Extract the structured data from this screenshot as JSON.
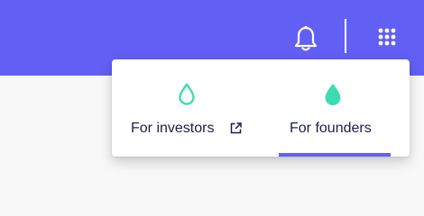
{
  "header": {
    "background": "#625ff5",
    "icons": [
      "bell-icon",
      "apps-grid-icon"
    ]
  },
  "menu": {
    "items": [
      {
        "label": "For investors",
        "icon": "drop-outline-icon",
        "external": true,
        "selected": false
      },
      {
        "label": "For founders",
        "icon": "drop-filled-icon",
        "external": false,
        "selected": true
      }
    ],
    "accent": "#3ddcb0",
    "selected_underline_color": "#625ff5"
  }
}
